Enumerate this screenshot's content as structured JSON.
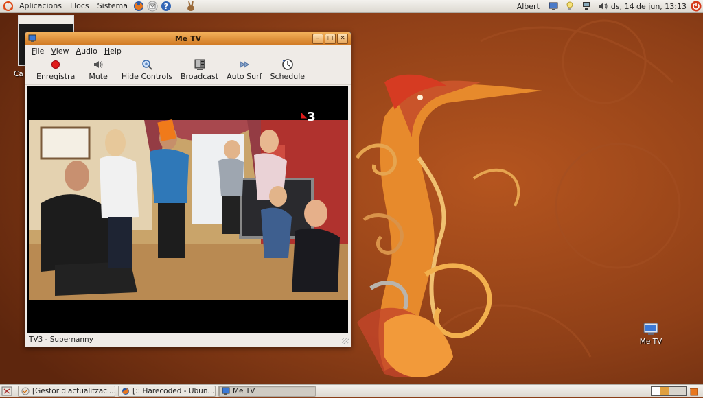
{
  "top_panel": {
    "menus": [
      "Aplicacions",
      "Llocs",
      "Sistema"
    ],
    "user": "Albert",
    "clock": "ds, 14 de jun, 13:13"
  },
  "desktop": {
    "icons": [
      {
        "label": "Ca"
      },
      {
        "label": "Me TV"
      }
    ]
  },
  "window": {
    "title": "Me TV",
    "menus": [
      "File",
      "View",
      "Audio",
      "Help"
    ],
    "toolbar": {
      "record": "Enregistra",
      "mute": "Mute",
      "hide_controls": "Hide Controls",
      "broadcast": "Broadcast",
      "auto_surf": "Auto Surf",
      "schedule": "Schedule"
    },
    "video": {
      "channel_logo": "3"
    },
    "status": "TV3 - Supernanny"
  },
  "taskbar": {
    "items": [
      {
        "label": "[Gestor d'actualitzaci...",
        "active": false
      },
      {
        "label": "[:: Harecoded - Ubun...",
        "active": false
      },
      {
        "label": "Me TV",
        "active": true
      }
    ]
  },
  "colors": {
    "wallpaper": "#8a3f18",
    "accent": "#e08a2a",
    "titlebar": "#d17a24"
  }
}
